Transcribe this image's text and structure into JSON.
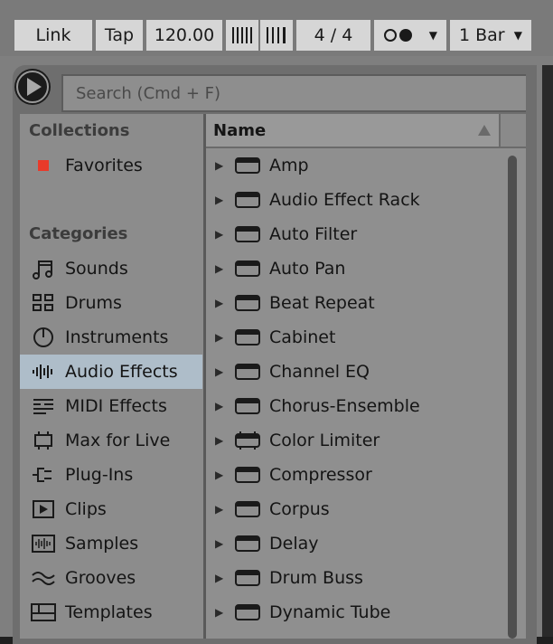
{
  "controls": {
    "link": "Link",
    "tap": "Tap",
    "tempo": "120.00",
    "time_signature": "4 / 4",
    "metronome_icon": "metronome-dot-icon",
    "quantize": "1 Bar"
  },
  "search": {
    "placeholder": "Search (Cmd + F)"
  },
  "sidebar": {
    "collections_header": "Collections",
    "collections": [
      {
        "label": "Favorites",
        "color": "#e83a2a"
      }
    ],
    "categories_header": "Categories",
    "categories": [
      {
        "label": "Sounds",
        "icon": "music-note-icon"
      },
      {
        "label": "Drums",
        "icon": "drum-grid-icon"
      },
      {
        "label": "Instruments",
        "icon": "power-dial-icon"
      },
      {
        "label": "Audio Effects",
        "icon": "waveform-icon",
        "selected": true
      },
      {
        "label": "MIDI Effects",
        "icon": "midi-lines-icon"
      },
      {
        "label": "Max for Live",
        "icon": "max-patch-icon"
      },
      {
        "label": "Plug-Ins",
        "icon": "plug-icon"
      },
      {
        "label": "Clips",
        "icon": "play-box-icon"
      },
      {
        "label": "Samples",
        "icon": "sample-wave-icon"
      },
      {
        "label": "Grooves",
        "icon": "groove-wave-icon"
      },
      {
        "label": "Templates",
        "icon": "template-icon"
      }
    ]
  },
  "list": {
    "column_name": "Name",
    "sort_icon": "sort-ascending-icon",
    "items": [
      "Amp",
      "Audio Effect Rack",
      "Auto Filter",
      "Auto Pan",
      "Beat Repeat",
      "Cabinet",
      "Channel EQ",
      "Chorus-Ensemble",
      "Color Limiter",
      "Compressor",
      "Corpus",
      "Delay",
      "Drum Buss",
      "Dynamic Tube"
    ]
  },
  "colors": {
    "selected": "#aebdc9",
    "favorite": "#e83a2a"
  }
}
